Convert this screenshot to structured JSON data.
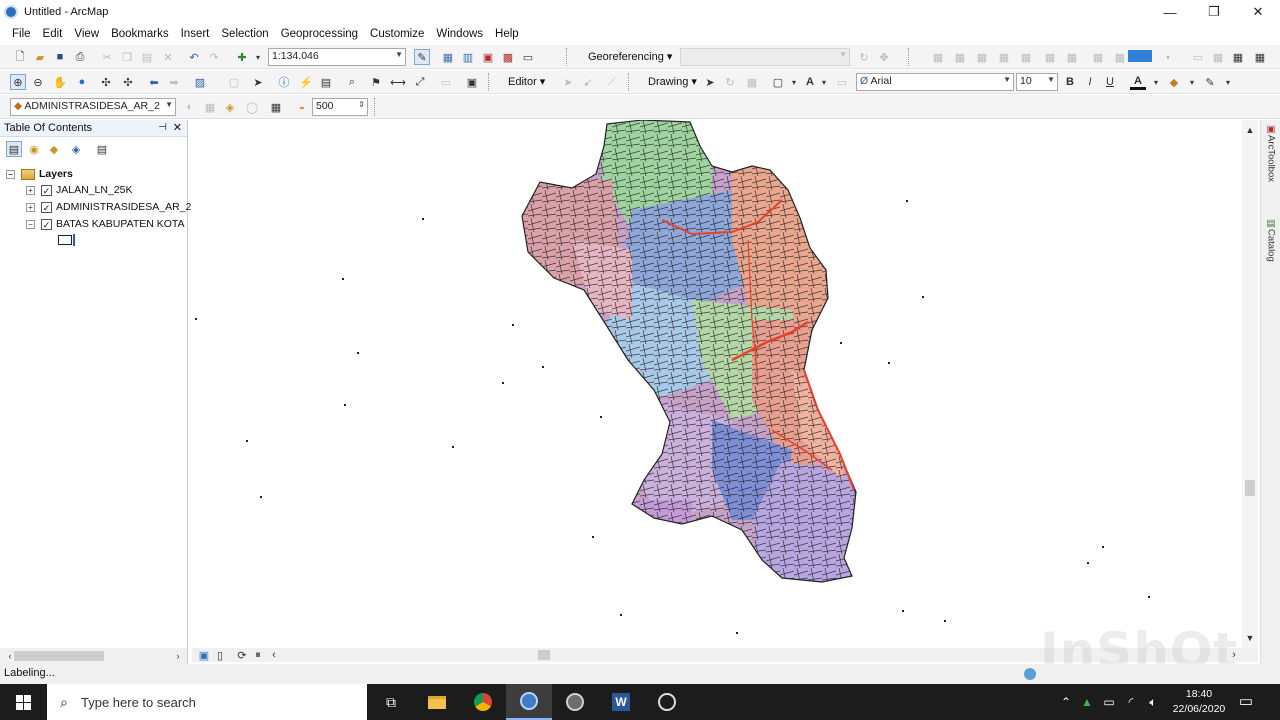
{
  "window": {
    "title": "Untitled - ArcMap",
    "minimize": "—",
    "maximize": "❐",
    "close": "✕"
  },
  "menu": [
    "File",
    "Edit",
    "View",
    "Bookmarks",
    "Insert",
    "Selection",
    "Geoprocessing",
    "Customize",
    "Windows",
    "Help"
  ],
  "standard_toolbar": {
    "scale": "1:134.046"
  },
  "georeferencing_toolbar": {
    "label": "Georeferencing ▾",
    "layer_combo": ""
  },
  "editor_toolbar": {
    "label": "Editor ▾"
  },
  "draw_toolbar": {
    "label": "Drawing ▾",
    "font": "Arial",
    "font_size": "10",
    "bold": "B",
    "italic": "I",
    "underline": "U",
    "font_color": "A"
  },
  "labeling_toolbar": {
    "layer": "ADMINISTRASIDESA_AR_2",
    "spacing": "500"
  },
  "toc": {
    "title": "Table Of Contents",
    "root": "Layers",
    "layers": [
      {
        "name": "JALAN_LN_25K",
        "checked": true,
        "expanded": false
      },
      {
        "name": "ADMINISTRASIDESA_AR_2",
        "checked": true,
        "expanded": false
      },
      {
        "name": "BATAS KABUPATEN KOTA",
        "checked": true,
        "expanded": true
      }
    ]
  },
  "side_tabs": [
    "ArcToolbox",
    "Catalog"
  ],
  "status": {
    "text": "Labeling..."
  },
  "taskbar": {
    "search_placeholder": "Type here to search",
    "time": "18:40",
    "date": "22/06/2020"
  },
  "watermark": "InShOt",
  "colors": {
    "road_red": "#e8402a",
    "title_bg": "#ffffff",
    "taskbar": "#1c1c1c"
  }
}
